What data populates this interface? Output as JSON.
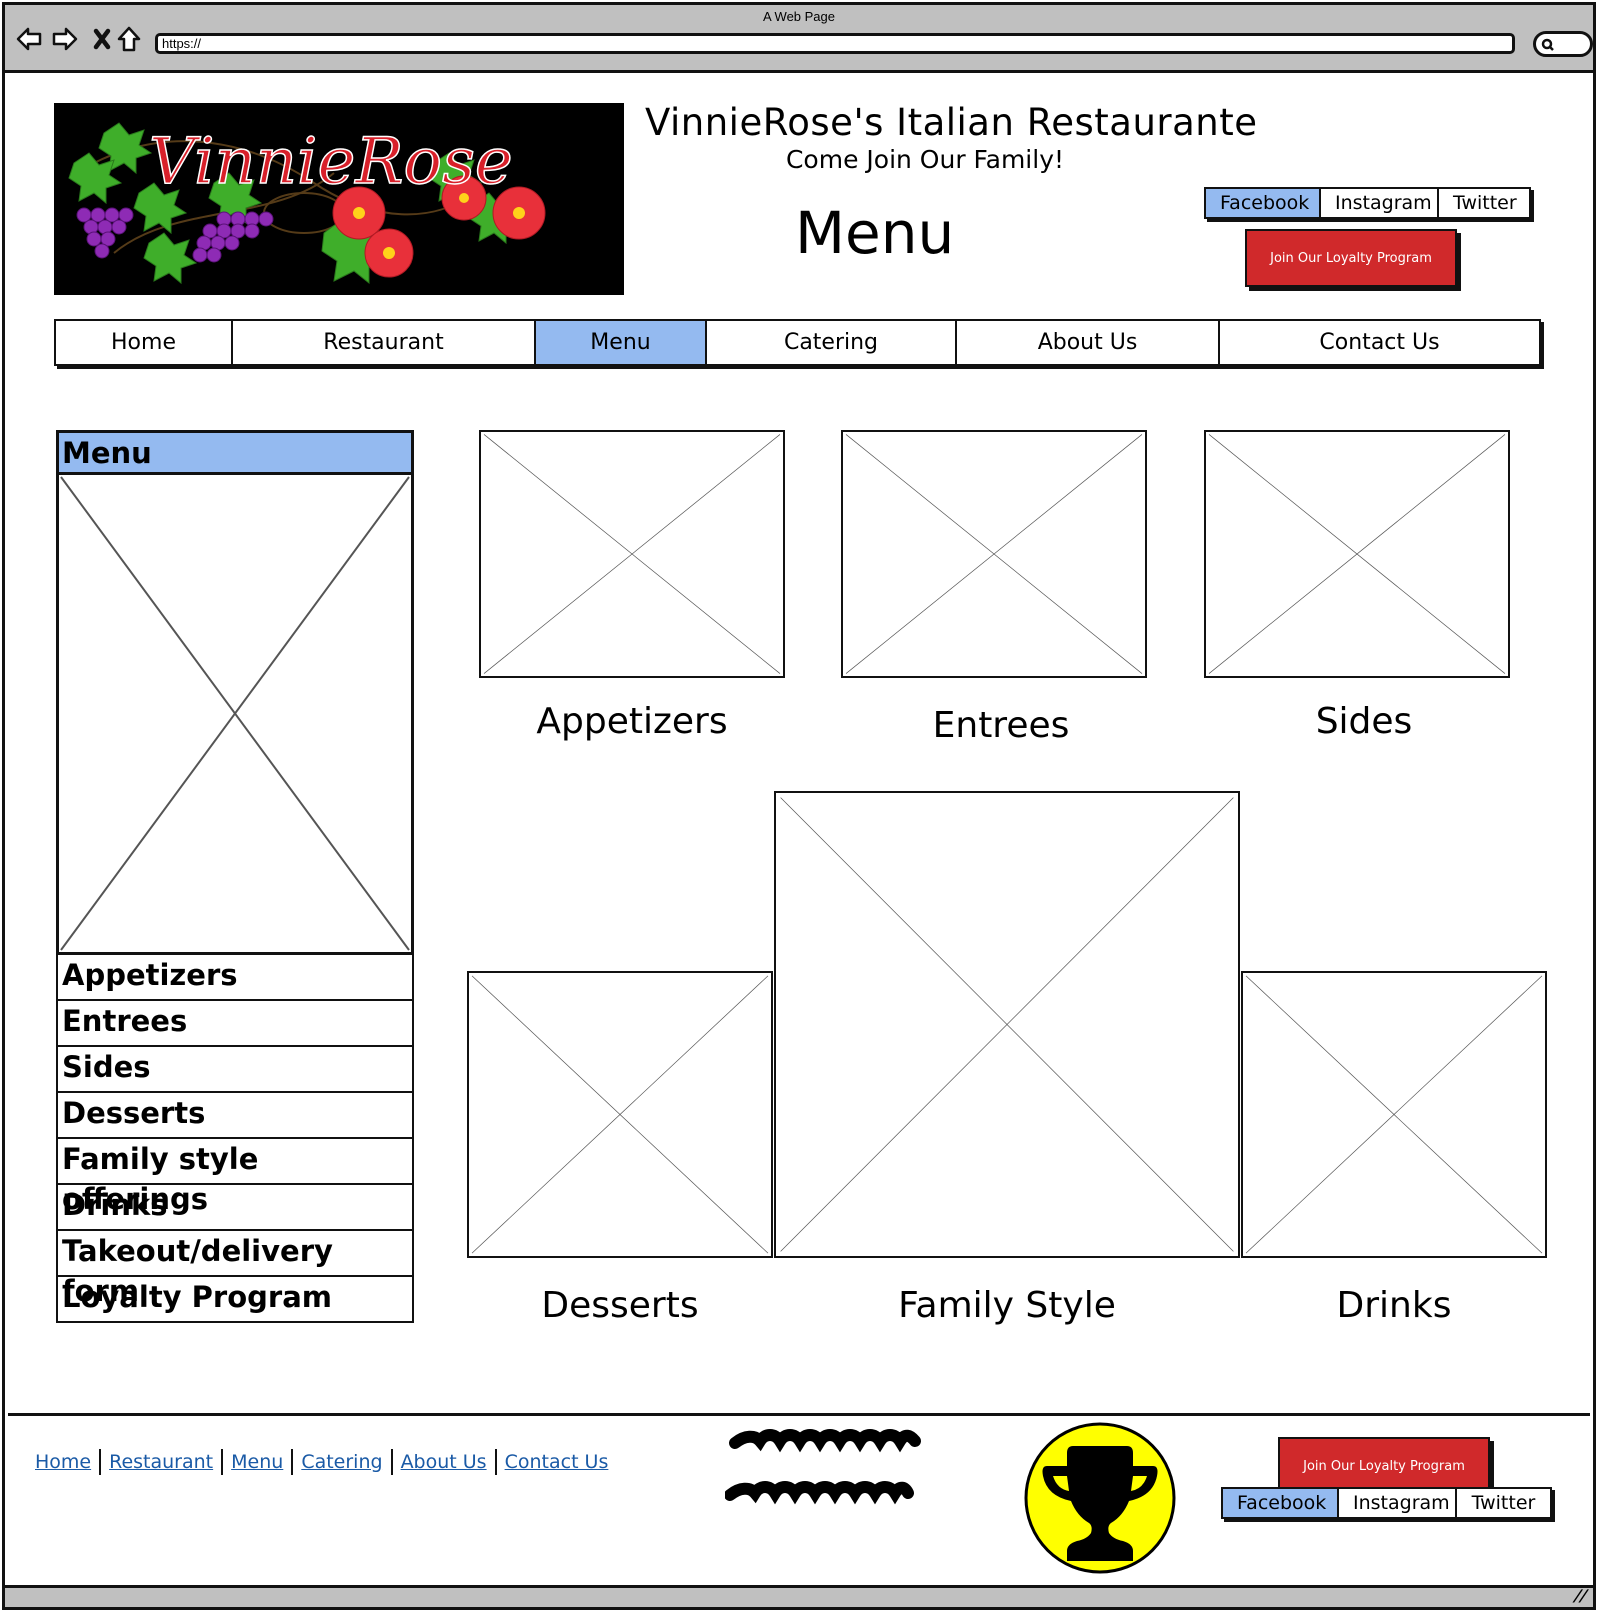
{
  "browser": {
    "window_title": "A Web Page",
    "url": "https://",
    "icons": [
      "back-arrow-icon",
      "forward-arrow-icon",
      "stop-icon",
      "home-icon",
      "search-icon"
    ]
  },
  "header": {
    "logo_alt": "VinnieRose",
    "site_title": "VinnieRose's Italian Restaurante",
    "tagline": "Come Join Our Family!",
    "page_heading": "Menu",
    "social": [
      {
        "label": "Facebook",
        "active": true
      },
      {
        "label": "Instagram",
        "active": false
      },
      {
        "label": "Twitter",
        "active": false
      }
    ],
    "loyalty_button": "Join Our Loyalty Program"
  },
  "nav": {
    "items": [
      {
        "label": "Home",
        "active": false
      },
      {
        "label": "Restaurant",
        "active": false
      },
      {
        "label": "Menu",
        "active": true
      },
      {
        "label": "Catering",
        "active": false
      },
      {
        "label": "About Us",
        "active": false
      },
      {
        "label": "Contact Us",
        "active": false
      }
    ]
  },
  "sidebar": {
    "title": "Menu",
    "items": [
      {
        "label": "Appetizers"
      },
      {
        "label": "Entrees"
      },
      {
        "label": "Sides"
      },
      {
        "label": "Desserts"
      },
      {
        "label": "Family style offerings"
      },
      {
        "label": "Drinks"
      },
      {
        "label": "Takeout/delivery form"
      },
      {
        "label": "Loyalty Program"
      }
    ]
  },
  "categories": [
    {
      "label": "Appetizers"
    },
    {
      "label": "Entrees"
    },
    {
      "label": "Sides"
    },
    {
      "label": "Desserts"
    },
    {
      "label": "Family Style"
    },
    {
      "label": "Drinks"
    }
  ],
  "footer": {
    "links": [
      {
        "label": "Home"
      },
      {
        "label": "Restaurant"
      },
      {
        "label": "Menu"
      },
      {
        "label": "Catering"
      },
      {
        "label": "About Us"
      },
      {
        "label": "Contact Us"
      }
    ],
    "loyalty_button": "Join Our Loyalty Program",
    "social": [
      {
        "label": "Facebook",
        "active": true
      },
      {
        "label": "Instagram",
        "active": false
      },
      {
        "label": "Twitter",
        "active": false
      }
    ],
    "badge_icon": "trophy-icon"
  },
  "colors": {
    "accent_blue": "#94baf0",
    "button_red": "#d0292b",
    "link_blue": "#1a5aa6",
    "trophy_yellow": "#ffff00",
    "chrome_gray": "#c0c0c0"
  }
}
